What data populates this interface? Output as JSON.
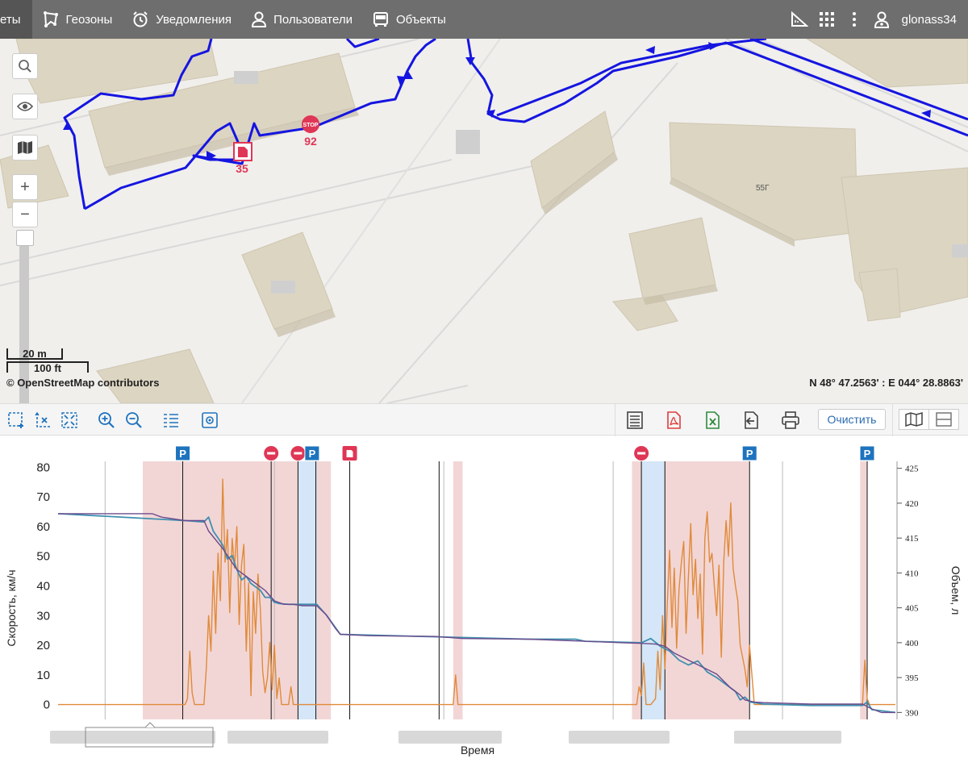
{
  "nav": {
    "items": [
      {
        "label": "еты",
        "icon": "reports-icon",
        "active": true
      },
      {
        "label": "Геозоны",
        "icon": "geozone-icon"
      },
      {
        "label": "Уведомления",
        "icon": "alarm-clock-icon"
      },
      {
        "label": "Пользователи",
        "icon": "user-icon"
      },
      {
        "label": "Объекты",
        "icon": "bus-icon"
      }
    ],
    "right_icons": [
      "ruler-icon",
      "grid-icon",
      "more-vert-icon",
      "account-icon"
    ],
    "user": "glonass34"
  },
  "map": {
    "scale_metric": "20 m",
    "scale_imperial": "100 ft",
    "attribution": "© OpenStreetMap contributors",
    "coordinates": "N 48° 47.2563' : E 044° 28.8863'",
    "building_label": "55Г",
    "stop_marker_label": "92",
    "fuel_marker_label": "35",
    "controls": [
      "search-icon",
      "eye-icon",
      "map-layers-icon",
      "zoom-in-icon",
      "zoom-out-icon"
    ],
    "zoom_in_label": "+",
    "zoom_out_label": "−"
  },
  "toolbar": {
    "left_buttons": [
      "select-zoom-icon",
      "zoom-x-axis-icon",
      "zoom-reset-icon",
      "zoom-in-icon",
      "zoom-out-icon",
      "legend-list-icon",
      "screenshot-icon"
    ],
    "right_buttons": [
      "table-icon",
      "pdf-icon",
      "excel-icon",
      "import-icon",
      "print-icon"
    ],
    "clear_label": "Очистить",
    "view_toggles": [
      "map-view-icon",
      "split-view-icon"
    ]
  },
  "colors": {
    "speed": "#e08a3a",
    "volume_raw": "#3f8fb0",
    "volume_smooth": "#6b4a8c",
    "motion_band": "#f2d6d6",
    "stop_band": "#d4e6f7",
    "parking_marker": "#1e73be",
    "stop_marker": "#e03655",
    "fuel_marker": "#e03655"
  },
  "chart_data": {
    "type": "line",
    "xlabel": "Время",
    "ylabel_left": "Скорость, км/ч",
    "ylabel_right": "Объем, л",
    "ylim_left": [
      -5,
      82
    ],
    "ylim_right": [
      389,
      426
    ],
    "yticks_left": [
      0,
      10,
      20,
      30,
      40,
      50,
      60,
      70,
      80
    ],
    "yticks_right": [
      390,
      395,
      400,
      405,
      410,
      415,
      420,
      425
    ],
    "x_range": [
      0,
      100
    ],
    "x_axis_note": "time-of-day labels in screenshot are pixelated/unreadable",
    "speed": [
      [
        0,
        0
      ],
      [
        27,
        0
      ],
      [
        27.5,
        2
      ],
      [
        28,
        18
      ],
      [
        28.5,
        4
      ],
      [
        29,
        0
      ],
      [
        31,
        0
      ],
      [
        31.5,
        12
      ],
      [
        32,
        30
      ],
      [
        32.5,
        18
      ],
      [
        33,
        45
      ],
      [
        33.5,
        24
      ],
      [
        34,
        51
      ],
      [
        34.5,
        35
      ],
      [
        35,
        76
      ],
      [
        35.5,
        48
      ],
      [
        36,
        59
      ],
      [
        36.5,
        31
      ],
      [
        37,
        56
      ],
      [
        37.5,
        46
      ],
      [
        38,
        60
      ],
      [
        38.5,
        27
      ],
      [
        39,
        47
      ],
      [
        39.5,
        54
      ],
      [
        40,
        18
      ],
      [
        40.5,
        41
      ],
      [
        41,
        3
      ],
      [
        41.5,
        38
      ],
      [
        42,
        24
      ],
      [
        42.5,
        44
      ],
      [
        43,
        32
      ],
      [
        43.5,
        11
      ],
      [
        44,
        4
      ],
      [
        44.5,
        9
      ],
      [
        45,
        21
      ],
      [
        45.5,
        5
      ],
      [
        46,
        20
      ],
      [
        46.5,
        2
      ],
      [
        47,
        9
      ],
      [
        47.5,
        0
      ],
      [
        48,
        0
      ],
      [
        49,
        0
      ],
      [
        49.5,
        6
      ],
      [
        50,
        0
      ],
      [
        51,
        0
      ],
      [
        84,
        0
      ],
      [
        84.5,
        10
      ],
      [
        85,
        0
      ],
      [
        123,
        0
      ],
      [
        123.5,
        6
      ],
      [
        124,
        3
      ],
      [
        124.5,
        14
      ],
      [
        125,
        0
      ],
      [
        126,
        0
      ],
      [
        127,
        2
      ],
      [
        127.5,
        18
      ],
      [
        128,
        5
      ],
      [
        128.5,
        30
      ],
      [
        129,
        12
      ],
      [
        129.5,
        34
      ],
      [
        130,
        52
      ],
      [
        130.5,
        26
      ],
      [
        131,
        46
      ],
      [
        131.5,
        19
      ],
      [
        132,
        39
      ],
      [
        132.5,
        48
      ],
      [
        133,
        55
      ],
      [
        133.5,
        24
      ],
      [
        134,
        43
      ],
      [
        134.5,
        61
      ],
      [
        135,
        37
      ],
      [
        135.5,
        49
      ],
      [
        136,
        29
      ],
      [
        136.5,
        44
      ],
      [
        137,
        17
      ],
      [
        137.5,
        56
      ],
      [
        138,
        65
      ],
      [
        138.5,
        48
      ],
      [
        139,
        51
      ],
      [
        139.5,
        40
      ],
      [
        140,
        30
      ],
      [
        140.5,
        47
      ],
      [
        141,
        16
      ],
      [
        141.5,
        48
      ],
      [
        142,
        62
      ],
      [
        142.5,
        50
      ],
      [
        143,
        68
      ],
      [
        143.5,
        46
      ],
      [
        144,
        40
      ],
      [
        144.5,
        35
      ],
      [
        145,
        20
      ],
      [
        145.5,
        16
      ],
      [
        146,
        12
      ],
      [
        146.5,
        6
      ],
      [
        147,
        20
      ],
      [
        147.5,
        10
      ],
      [
        148,
        0
      ],
      [
        171,
        0
      ],
      [
        171.5,
        15
      ],
      [
        172,
        2
      ],
      [
        172.5,
        0
      ],
      [
        178,
        0
      ]
    ],
    "volume_smooth": [
      [
        0,
        418.5
      ],
      [
        20,
        418.5
      ],
      [
        22,
        418
      ],
      [
        27,
        417.5
      ],
      [
        29,
        417.5
      ],
      [
        31,
        417.5
      ],
      [
        32,
        416
      ],
      [
        35,
        413.5
      ],
      [
        38,
        410.5
      ],
      [
        41,
        409
      ],
      [
        44,
        407.5
      ],
      [
        46,
        406
      ],
      [
        48,
        405.5
      ],
      [
        50,
        405.5
      ],
      [
        52,
        405.3
      ],
      [
        55,
        405.3
      ],
      [
        57,
        404
      ],
      [
        59,
        402
      ],
      [
        60,
        401.2
      ],
      [
        66,
        401
      ],
      [
        80,
        400.9
      ],
      [
        86,
        400.6
      ],
      [
        100,
        400.5
      ],
      [
        112,
        400.2
      ],
      [
        120,
        400
      ],
      [
        124,
        399.9
      ],
      [
        127,
        399.8
      ],
      [
        129,
        399.5
      ],
      [
        131,
        398.5
      ],
      [
        134,
        397.5
      ],
      [
        137,
        396.5
      ],
      [
        140,
        395.5
      ],
      [
        143,
        393.5
      ],
      [
        145,
        392.5
      ],
      [
        146,
        391.8
      ],
      [
        148,
        391.5
      ],
      [
        150,
        391.4
      ],
      [
        160,
        391.2
      ],
      [
        170,
        391.2
      ],
      [
        171,
        391.2
      ],
      [
        173,
        390.5
      ],
      [
        175,
        390
      ],
      [
        178,
        390
      ]
    ],
    "volume_raw": [
      [
        0,
        418.5
      ],
      [
        27,
        417.5
      ],
      [
        31,
        417.3
      ],
      [
        32,
        418
      ],
      [
        33,
        416
      ],
      [
        34,
        415
      ],
      [
        35,
        414
      ],
      [
        36,
        412
      ],
      [
        37,
        412.5
      ],
      [
        38,
        410.5
      ],
      [
        39,
        409
      ],
      [
        40,
        409.5
      ],
      [
        41,
        408.5
      ],
      [
        42,
        408
      ],
      [
        43,
        407.5
      ],
      [
        44,
        406.5
      ],
      [
        45,
        406.5
      ],
      [
        46,
        405.8
      ],
      [
        47,
        405.6
      ],
      [
        49,
        405.5
      ],
      [
        55,
        405.5
      ],
      [
        57,
        404
      ],
      [
        60,
        401.2
      ],
      [
        100,
        400.5
      ],
      [
        110,
        400.5
      ],
      [
        112,
        400.2
      ],
      [
        124,
        400
      ],
      [
        126,
        400.6
      ],
      [
        128,
        399.5
      ],
      [
        130,
        398.8
      ],
      [
        132,
        397.5
      ],
      [
        134,
        396.8
      ],
      [
        136,
        397.4
      ],
      [
        138,
        395.8
      ],
      [
        140,
        395
      ],
      [
        142,
        394
      ],
      [
        144,
        393
      ],
      [
        145,
        391.8
      ],
      [
        146,
        392.2
      ],
      [
        147,
        391.5
      ],
      [
        150,
        391.2
      ],
      [
        160,
        391
      ],
      [
        171,
        391
      ],
      [
        172,
        391.5
      ],
      [
        173,
        390.4
      ],
      [
        178,
        390
      ]
    ],
    "motion_bands": [
      [
        18,
        58
      ],
      [
        84,
        86
      ],
      [
        122,
        126
      ],
      [
        129,
        147
      ],
      [
        170.5,
        172
      ]
    ],
    "stop_bands": [
      [
        51,
        55
      ],
      [
        124,
        129
      ]
    ],
    "event_lines": [
      26.5,
      45.3,
      51,
      54.8,
      62,
      81,
      124,
      129,
      147,
      172
    ],
    "markers": [
      {
        "type": "parking",
        "label": "P",
        "x": 26.5
      },
      {
        "type": "stop",
        "x": 45.3
      },
      {
        "type": "stop",
        "x": 51
      },
      {
        "type": "parking",
        "label": "P",
        "x": 54
      },
      {
        "type": "fuel",
        "x": 62
      },
      {
        "type": "stop",
        "x": 124
      },
      {
        "type": "parking",
        "label": "P",
        "x": 147
      },
      {
        "type": "parking",
        "label": "P",
        "x": 172
      }
    ]
  }
}
